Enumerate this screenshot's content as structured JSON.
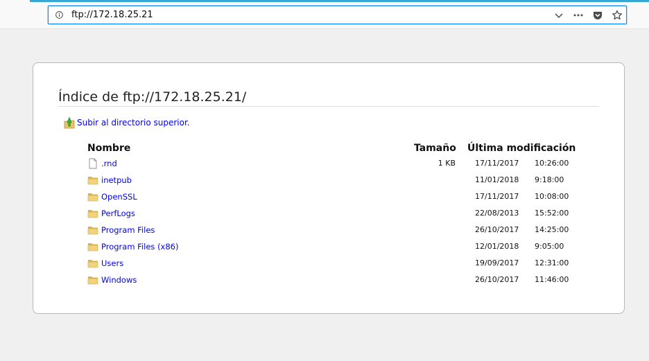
{
  "browser": {
    "url": "ftp://172.18.25.21",
    "accent_color": "#37a7d6",
    "focus_color": "#0a84ff",
    "icons": [
      "info-icon",
      "dropdown-chevron-icon",
      "page-actions-icon",
      "pocket-icon",
      "bookmark-star-icon"
    ]
  },
  "listing": {
    "title": "Índice de ftp://172.18.25.21/",
    "up_link": "Subir al directorio superior.",
    "headers": {
      "name": "Nombre",
      "size": "Tamaño",
      "modified": "Última modificación"
    },
    "link_color": "#0000ee",
    "rows": [
      {
        "name": ".rnd",
        "type": "file",
        "size": "1 KB",
        "date": "17/11/2017",
        "time": "10:26:00"
      },
      {
        "name": "inetpub",
        "type": "folder",
        "size": "",
        "date": "11/01/2018",
        "time": "9:18:00"
      },
      {
        "name": "OpenSSL",
        "type": "folder",
        "size": "",
        "date": "17/11/2017",
        "time": "10:08:00"
      },
      {
        "name": "PerfLogs",
        "type": "folder",
        "size": "",
        "date": "22/08/2013",
        "time": "15:52:00"
      },
      {
        "name": "Program Files",
        "type": "folder",
        "size": "",
        "date": "26/10/2017",
        "time": "14:25:00"
      },
      {
        "name": "Program Files (x86)",
        "type": "folder",
        "size": "",
        "date": "12/01/2018",
        "time": "9:05:00"
      },
      {
        "name": "Users",
        "type": "folder",
        "size": "",
        "date": "19/09/2017",
        "time": "12:31:00"
      },
      {
        "name": "Windows",
        "type": "folder",
        "size": "",
        "date": "26/10/2017",
        "time": "11:46:00"
      }
    ]
  }
}
